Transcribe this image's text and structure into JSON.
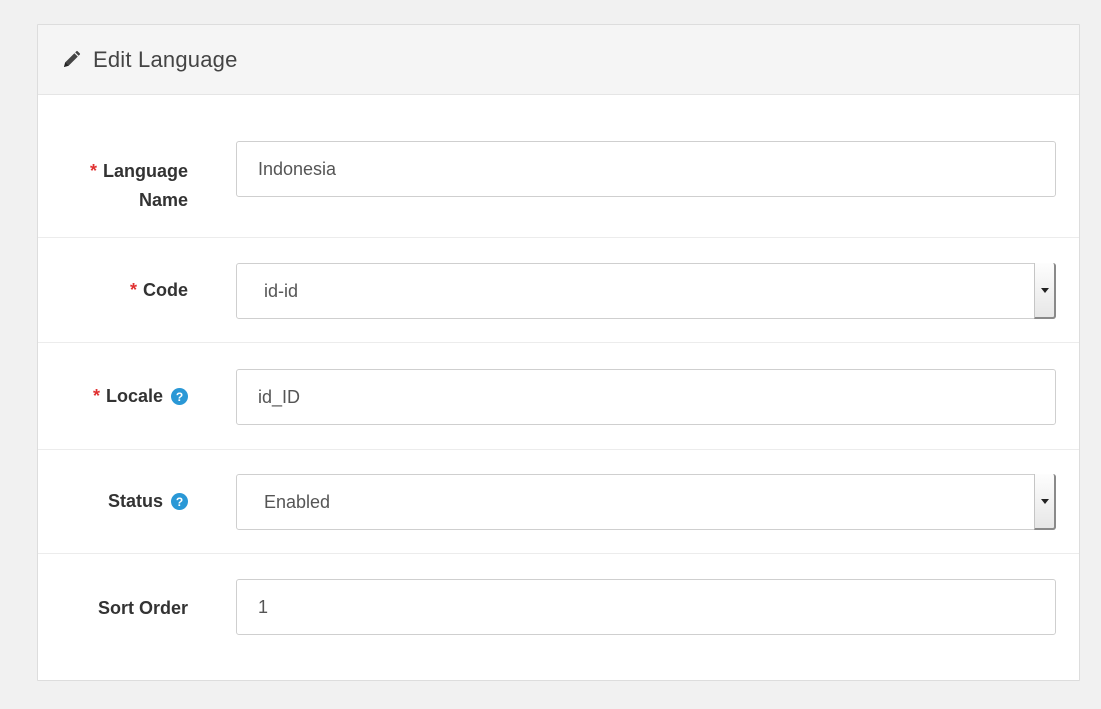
{
  "panel": {
    "title": "Edit Language",
    "title_icon": "pencil-icon"
  },
  "form": {
    "required_marker": "*",
    "help_marker": "?",
    "language_name": {
      "label": "Language Name",
      "value": "Indonesia",
      "required": true
    },
    "code": {
      "label": "Code",
      "value": "id-id",
      "required": true
    },
    "locale": {
      "label": "Locale",
      "value": "id_ID",
      "required": true,
      "help_icon": "question-circle-icon"
    },
    "status": {
      "label": "Status",
      "value": "Enabled",
      "help_icon": "question-circle-icon"
    },
    "sort_order": {
      "label": "Sort Order",
      "value": "1"
    }
  },
  "colors": {
    "required": "#e03131",
    "help": "#2a98d6",
    "heading_bg": "#f5f5f5"
  }
}
